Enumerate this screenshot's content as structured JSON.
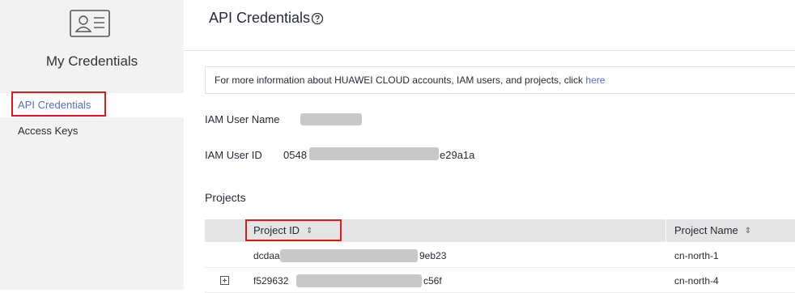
{
  "sidebar": {
    "title": "My Credentials",
    "items": [
      {
        "label": "API Credentials",
        "active": true
      },
      {
        "label": "Access Keys",
        "active": false
      }
    ]
  },
  "header": {
    "title": "API Credentials",
    "help_icon": "help-circle-icon"
  },
  "info": {
    "text": "For more information about HUAWEI CLOUD accounts, IAM users, and projects, click ",
    "link": "here"
  },
  "fields": {
    "user_name_label": "IAM User Name",
    "user_id_label": "IAM User ID",
    "user_id_prefix": "0548",
    "user_id_suffix": "e29a1a"
  },
  "projects": {
    "title": "Projects",
    "columns": [
      "Project ID",
      "Project Name"
    ],
    "sort_icon": "⇕",
    "rows": [
      {
        "id_prefix": "dcdaa",
        "id_suffix": "9eb23",
        "name": "cn-north-1",
        "expandable": false
      },
      {
        "id_prefix": "f529632",
        "id_suffix": "c56f",
        "name": "cn-north-4",
        "expandable": true
      }
    ]
  },
  "colors": {
    "accent": "#526ecc",
    "highlight": "#e01a1a",
    "sidebar_bg": "#f2f2f2",
    "table_header_bg": "#e4e4e4"
  }
}
